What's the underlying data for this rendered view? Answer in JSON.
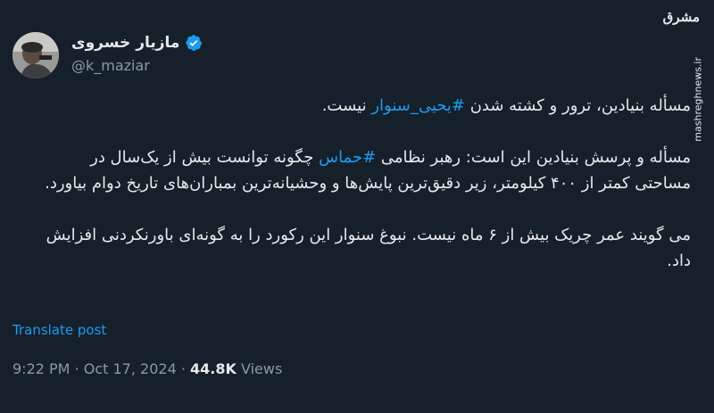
{
  "author": {
    "display_name": "مازیار خسروی",
    "handle": "@k_maziar",
    "verified": true
  },
  "watermark": {
    "logo_text": "مشرق",
    "url": "mashreghnews.ir"
  },
  "tweet": {
    "p1": {
      "before": "مسأله بنیادین، ترور و کشته شدن ",
      "hashtag": "#یحیی_سنوار",
      "after": " نیست."
    },
    "p2": {
      "before": "مسأله و پرسش بنیادین این است: رهبر نظامی ",
      "hashtag": "#حماس",
      "after": " چگونه توانست بیش از یک‌سال در مساحتی کمتر از ۴۰۰ کیلومتر، زیر دقیق‌ترین پایش‌ها و وحشیانه‌ترین بمباران‌های تاریخ دوام بیاورد."
    },
    "p3": "می گویند عمر چریک بیش از ۶ ماه نیست. نبوغ  سنوار این رکورد را به گونه‌ای باورنکردنی افزایش داد."
  },
  "translate_label": "Translate post",
  "meta": {
    "time": "9:22 PM",
    "separator": "·",
    "date": "Oct 17, 2024",
    "views_count": "44.8K",
    "views_label": "Views"
  },
  "colors": {
    "background": "#15202b",
    "text": "#e7e9ea",
    "secondary": "#8b98a5",
    "link": "#1d9bf0"
  }
}
